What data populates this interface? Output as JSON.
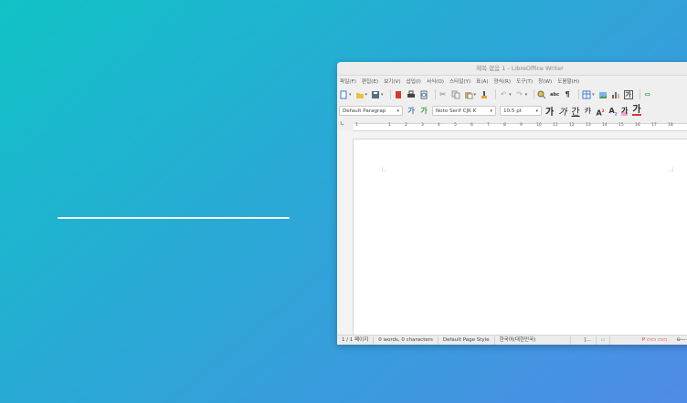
{
  "window": {
    "title": "제목 없음 1 - LibreOffice Writer"
  },
  "menu": [
    "파일(F)",
    "편집(E)",
    "보기(V)",
    "삽입(I)",
    "서식(O)",
    "스타일(Y)",
    "표(A)",
    "양식(R)",
    "도구(T)",
    "창(W)",
    "도움말(H)"
  ],
  "toolbar": {
    "paragraph_style": "Default Paragrap",
    "font_name": "Noto Serif CJK K",
    "font_size": "10.5 pt",
    "hangul_glyphs": [
      "가",
      "가",
      "간",
      "캬"
    ],
    "style_glyphs": [
      "가",
      "가"
    ]
  },
  "ruler": {
    "ticks": [
      "1",
      "",
      "1",
      "2",
      "3",
      "4",
      "5",
      "6",
      "7",
      "8",
      "9",
      "10",
      "11",
      "12",
      "13",
      "14",
      "15",
      "16",
      "17",
      "18"
    ]
  },
  "status": {
    "page": "1 / 1 페이지",
    "words": "0 words, 0 characters",
    "page_style": "Default Page Style",
    "language": "한국어(대한민국)",
    "bracket": "[..."
  },
  "colors": {
    "accent_blue": "#3f78c9",
    "highlight": "#e8c23a",
    "red": "#d23a2a"
  }
}
